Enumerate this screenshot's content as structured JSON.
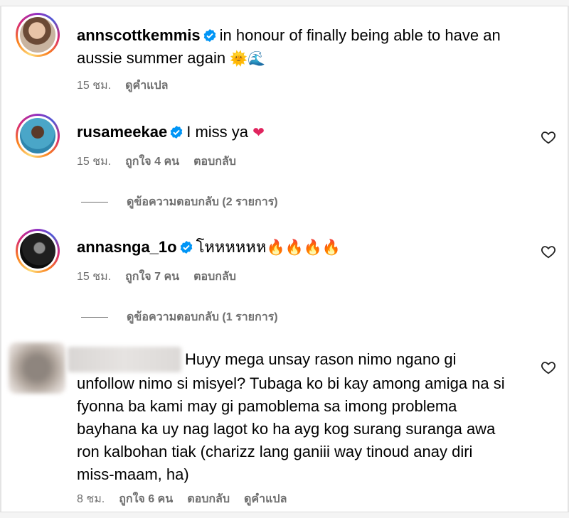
{
  "comments": [
    {
      "username": "annscottkemmis",
      "text_line1": "in honour of finally being able to have an",
      "text_line2": "aussie summer again",
      "emojis": "🌞🌊",
      "time": "15 ชม.",
      "translate": "ดูคำแปล"
    },
    {
      "username": "rusameekae",
      "text": "I miss ya",
      "emoji": "❤",
      "time": "15 ชม.",
      "likes": "ถูกใจ 4 คน",
      "reply": "ตอบกลับ",
      "view_replies": "ดูข้อความตอบกลับ (2 รายการ)"
    },
    {
      "username": "annasnga_1o",
      "text": "โหหหหหห",
      "emojis": "🔥🔥🔥🔥",
      "time": "15 ชม.",
      "likes": "ถูกใจ 7 คน",
      "reply": "ตอบกลับ",
      "view_replies": "ดูข้อความตอบกลับ (1 รายการ)"
    },
    {
      "text_lines": [
        "Huyy mega unsay rason nimo ngano gi",
        "unfollow nimo si misyel? Tubaga ko bi kay among amiga na si",
        "fyonna ba kami may gi pamoblema sa imong problema",
        "bayhana ka uy nag lagot ko ha ayg kog surang suranga awa",
        "ron kalbohan tiak (charizz lang ganiii way tinoud anay diri",
        "miss-maam, ha)"
      ],
      "time": "8 ชม.",
      "likes": "ถูกใจ 6 คน",
      "reply": "ตอบกลับ",
      "translate": "ดูคำแปล"
    }
  ],
  "colors": {
    "verified": "#0095f6",
    "meta": "#6f6f6f",
    "heart": "#e0245e"
  }
}
